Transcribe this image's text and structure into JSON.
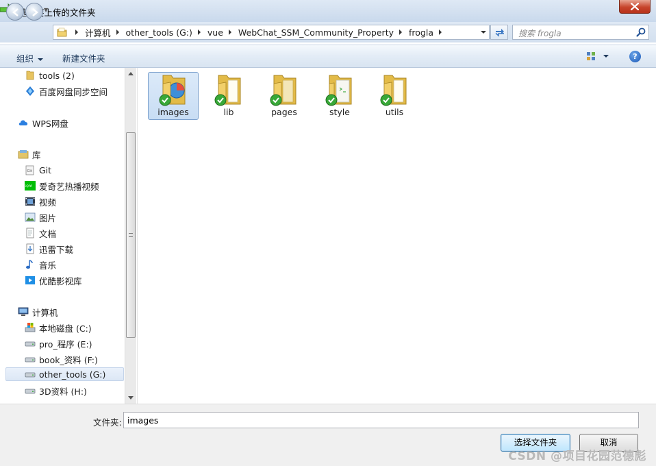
{
  "window": {
    "title": "选择要上传的文件夹"
  },
  "nav": {
    "crumbs": [
      "计算机",
      "other_tools (G:)",
      "vue",
      "WebChat_SSM_Community_Property",
      "frogla"
    ],
    "search_placeholder": "搜索 frogla"
  },
  "toolbar": {
    "organize": "组织",
    "new_folder": "新建文件夹",
    "help": "?"
  },
  "sidebar": {
    "items": [
      {
        "label": "tools (2)",
        "icon": "folder-icon"
      },
      {
        "label": "百度网盘同步空间",
        "icon": "baidu-sync-icon"
      },
      {
        "label": "WPS网盘",
        "icon": "cloud-icon"
      },
      {
        "label": "库",
        "icon": "library-icon"
      },
      {
        "label": "Git",
        "icon": "git-library-icon"
      },
      {
        "label": "爱奇艺热播视频",
        "icon": "iqiyi-icon"
      },
      {
        "label": "视频",
        "icon": "video-icon"
      },
      {
        "label": "图片",
        "icon": "picture-icon"
      },
      {
        "label": "文档",
        "icon": "document-icon"
      },
      {
        "label": "迅雷下载",
        "icon": "download-icon"
      },
      {
        "label": "音乐",
        "icon": "music-icon"
      },
      {
        "label": "优酷影视库",
        "icon": "youku-icon"
      },
      {
        "label": "计算机",
        "icon": "computer-icon"
      },
      {
        "label": "本地磁盘 (C:)",
        "icon": "system-drive-icon"
      },
      {
        "label": "pro_程序 (E:)",
        "icon": "drive-icon"
      },
      {
        "label": "book_资料 (F:)",
        "icon": "drive-icon"
      },
      {
        "label": "other_tools (G:)",
        "icon": "drive-icon"
      },
      {
        "label": "3D资料 (H:)",
        "icon": "drive-icon"
      }
    ],
    "selected": "other_tools (G:)"
  },
  "files": [
    {
      "name": "images",
      "selected": true
    },
    {
      "name": "lib",
      "selected": false
    },
    {
      "name": "pages",
      "selected": false
    },
    {
      "name": "style",
      "selected": false
    },
    {
      "name": "utils",
      "selected": false
    }
  ],
  "footer": {
    "folder_label": "文件夹:",
    "folder_value": "images",
    "select_button": "选择文件夹",
    "cancel_button": "取消",
    "watermark": "CSDN @项目花园范德彪"
  },
  "colors": {
    "accent": "#3c7fb1",
    "selection": "#c8ddf4",
    "close": "#c7452c",
    "check": "#2f9d2f"
  }
}
